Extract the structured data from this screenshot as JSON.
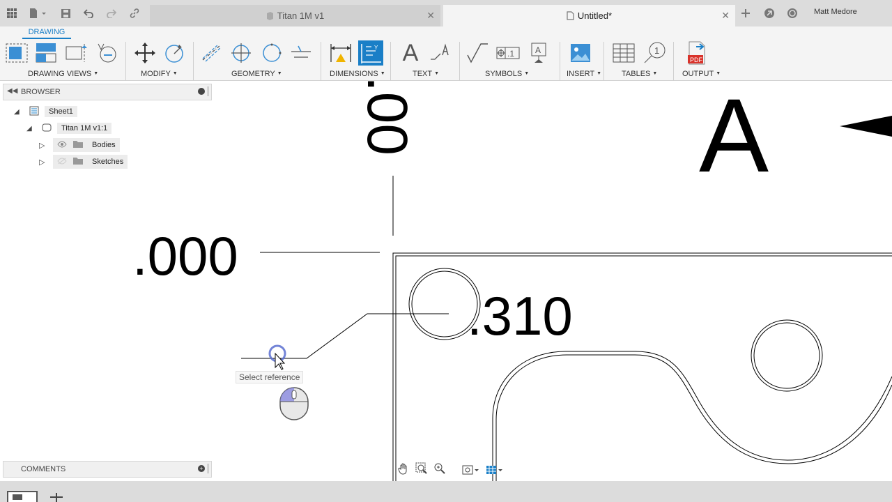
{
  "topbar": {
    "tabs": [
      {
        "label": "Titan 1M v1"
      },
      {
        "label": "Untitled*"
      }
    ],
    "user": "Matt Medore"
  },
  "ribbon": {
    "workspace_tab": "DRAWING",
    "groups": [
      {
        "label": "DRAWING VIEWS"
      },
      {
        "label": "MODIFY"
      },
      {
        "label": "GEOMETRY"
      },
      {
        "label": "DIMENSIONS"
      },
      {
        "label": "TEXT"
      },
      {
        "label": "SYMBOLS"
      },
      {
        "label": "INSERT"
      },
      {
        "label": "TABLES"
      },
      {
        "label": "OUTPUT"
      }
    ],
    "text_tool_glyph": "A",
    "pdf_label": "PDF"
  },
  "browser": {
    "title": "BROWSER",
    "items": [
      {
        "label": "Sheet1"
      },
      {
        "label": "Titan 1M v1:1"
      },
      {
        "label": "Bodies"
      },
      {
        "label": "Sketches"
      }
    ]
  },
  "comments": {
    "title": "COMMENTS"
  },
  "canvas": {
    "dim_top": ".00",
    "dim_left": ".000",
    "dim_hole": ".310",
    "section_label": "A",
    "tooltip": "Select reference"
  },
  "icons": [
    "app-grid-icon",
    "file-icon",
    "save-icon",
    "undo-icon",
    "redo-icon",
    "link-icon",
    "new-tab-icon",
    "extensions-icon",
    "clock-icon",
    "mouse-icon",
    "pan-icon",
    "zoom-window-icon",
    "zoom-icon",
    "display-settings-icon",
    "grid-settings-icon",
    "new-sheet-icon",
    "add-sheet-icon"
  ],
  "colors": {
    "accent": "#1a7fc7",
    "pdf_red": "#d9332b"
  }
}
